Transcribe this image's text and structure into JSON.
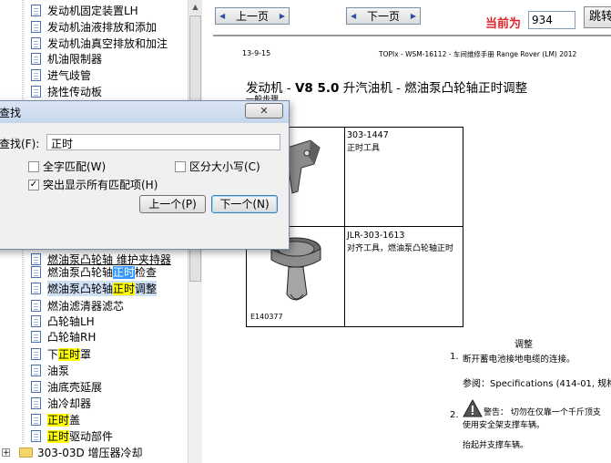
{
  "tree": {
    "items": [
      {
        "label": "发动机固定装置LH"
      },
      {
        "label": "发动机油液排放和添加"
      },
      {
        "label": "发动机油真空排放和加注"
      },
      {
        "label": "机油限制器"
      },
      {
        "label": "进气歧管"
      },
      {
        "label": "挠性传动板"
      },
      {
        "label": "燃油泵凸轮轴 维护夹持器"
      },
      {
        "pre": "燃油泵凸轮轴",
        "hl": "正时",
        "post": "检查"
      },
      {
        "pre": "燃油泵凸轮轴",
        "hl": "正时",
        "post": "调整"
      },
      {
        "label": "燃油滤清器滤芯"
      },
      {
        "label": "凸轮轴LH"
      },
      {
        "label": "凸轮轴RH"
      },
      {
        "pre": "下",
        "hl": "正时",
        "post": "罩"
      },
      {
        "label": "油泵"
      },
      {
        "label": "油底壳延展"
      },
      {
        "label": "油冷却器"
      },
      {
        "pre": "",
        "hl": "正时",
        "post": "盖"
      },
      {
        "pre": "",
        "hl": "正时",
        "post": "驱动部件"
      }
    ],
    "folder": {
      "label": "303-03D 增压器冷却",
      "expander": "+"
    }
  },
  "topbar": {
    "prev_label": "上一页",
    "next_label": "下一页",
    "current_label": "当前为",
    "page_value": "934",
    "jump_label": "跳转"
  },
  "doc": {
    "header_left": "13-9-15",
    "header_right": "TOPIx - WSM-16112 - 车间维修手册 Range Rover (LM) 2012",
    "title_pre": "发动机 - ",
    "title_bold": "V8 5.0",
    "title_post": " 升汽油机 - 燃油泵凸轮轴正时调整",
    "subtitle": "一般步骤",
    "tool1_code": "303-1447",
    "tool1_desc": "正时工具",
    "tool2_code": "JLR-303-1613",
    "tool2_desc": "对齐工具，燃油泵凸轮轴正时",
    "figure_ref": "E140377",
    "section_heading": "调整",
    "step1_num": "1.",
    "step1_text": "断开蓄电池接地电缆的连接。",
    "ref_label": "参阅：",
    "ref_text": "Specifications (414-01, 规格",
    "step2_num": "2.",
    "step2_text": "警告： 切勿在仅靠一个千斤顶支",
    "step2_text2": "使用安全架支撑车辆。",
    "step2_text3": "抬起并支撑车辆。"
  },
  "find_dialog": {
    "title": "查找",
    "close_symbol": "✕",
    "find_label": "查找(F):",
    "find_value": "正时",
    "opt_whole_word": "全字匹配(W)",
    "opt_whole_word_checked": false,
    "opt_match_case": "区分大小写(C)",
    "opt_match_case_checked": false,
    "opt_highlight_all": "突出显示所有匹配项(H)",
    "opt_highlight_all_checked": true,
    "prev_button": "上一个(P)",
    "next_button": "下一个(N)"
  },
  "colors": {
    "highlight": "#ffff00",
    "selected_highlight": "#3399ff",
    "accent_red": "#e0242a"
  }
}
